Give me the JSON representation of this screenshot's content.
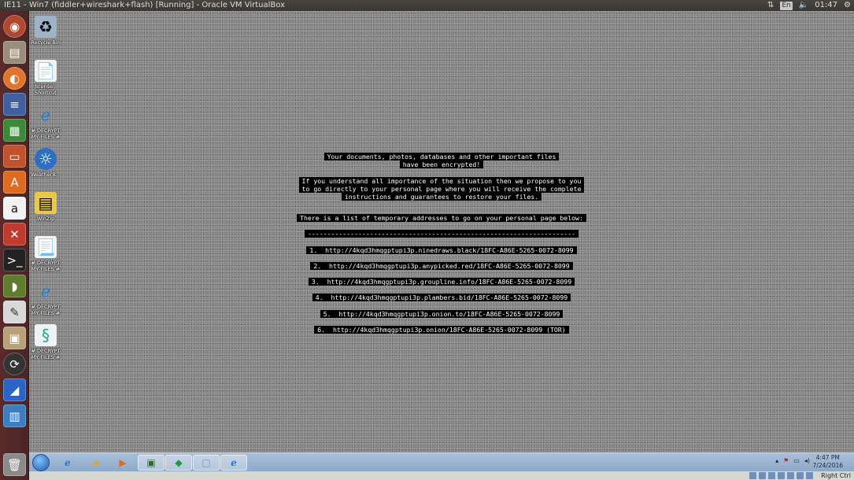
{
  "topbar": {
    "window_title": "IE11 - Win7 (fiddler+wireshark+flash) [Running] - Oracle VM VirtualBox",
    "keyboard_layout": "En",
    "time": "01:47"
  },
  "desktop_icons": [
    {
      "label": "Recycle Bin"
    },
    {
      "label": "license - Shortcut"
    },
    {
      "label": "# DECRYPT MY FILES #"
    },
    {
      "label": "WeatherB..."
    },
    {
      "label": "WinZip"
    },
    {
      "label": "# DECRYPT MY FILES #"
    },
    {
      "label": "# DECRYPT MY FILES #"
    },
    {
      "label": "# DECRYPT MY FILES #"
    }
  ],
  "note": {
    "line1": "Your documents, photos, databases and other important files",
    "line2": "have been encrypted!",
    "para2_line1": "If you understand all importance of the situation then we propose to you",
    "para2_line2": "to go directly to your personal page where you will receive the complete",
    "para2_line3": "instructions and guarantees to restore your files.",
    "list_intro": "There is a list of temporary addresses to go on your personal page below:",
    "separator": "---------------------------------------------------------------------",
    "links": [
      "1.  http://4kqd3hmqgptupi3p.ninedraws.black/18FC-A86E-5265-0072-8099",
      "2.  http://4kqd3hmqgptupi3p.anypicked.red/18FC-A86E-5265-0072-8099",
      "3.  http://4kqd3hmqgptupi3p.groupline.info/18FC-A86E-5265-0072-8099",
      "4.  http://4kqd3hmqgptupi3p.plambers.bid/18FC-A86E-5265-0072-8099",
      "5.  http://4kqd3hmqgptupi3p.onion.to/18FC-A86E-5265-0072-8099",
      "6.  http://4kqd3hmqgptupi3p.onion/18FC-A86E-5265-0072-8099 (TOR)"
    ]
  },
  "taskbar": {
    "clock_time": "4:47 PM",
    "clock_date": "7/24/2016"
  },
  "vbox_status": {
    "host_key": "Right Ctrl"
  }
}
